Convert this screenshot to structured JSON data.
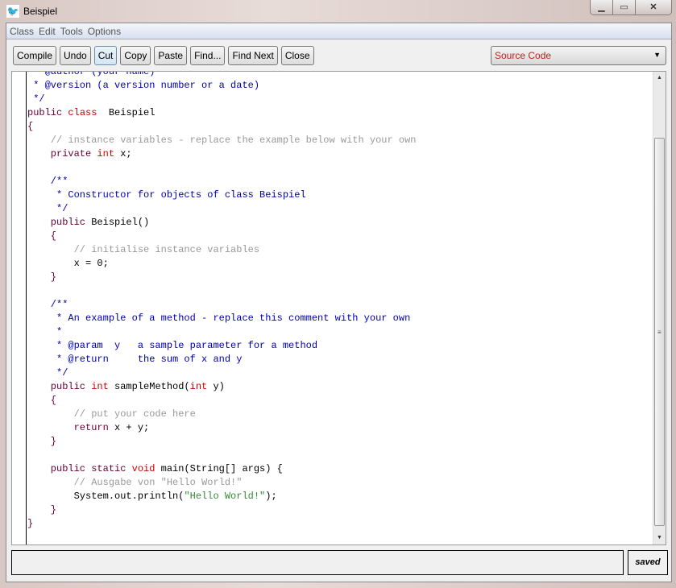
{
  "window": {
    "title": "Beispiel",
    "icon": "bluej-bird-icon",
    "controls": [
      "minimize",
      "maximize",
      "close"
    ]
  },
  "menu": [
    "Class",
    "Edit",
    "Tools",
    "Options"
  ],
  "toolbar": [
    "Compile",
    "Undo",
    "Cut",
    "Copy",
    "Paste",
    "Find...",
    "Find Next",
    "Close"
  ],
  "view_selector": {
    "selected": "Source Code"
  },
  "code_lines": [
    [
      [
        "doc",
        " * @author (your name)"
      ]
    ],
    [
      [
        "doc",
        " * @version (a version number or a date)"
      ]
    ],
    [
      [
        "doc",
        " */"
      ]
    ],
    [
      [
        "kw",
        "public "
      ],
      [
        "ty",
        "class"
      ],
      [
        "",
        "  Beispiel"
      ]
    ],
    [
      [
        "br",
        "{"
      ]
    ],
    [
      [
        "cm",
        "    // instance variables - replace the example below with your own"
      ]
    ],
    [
      [
        "kw",
        "    private "
      ],
      [
        "ty",
        "int"
      ],
      [
        "",
        " x;"
      ]
    ],
    [],
    [
      [
        "doc",
        "    /**"
      ]
    ],
    [
      [
        "doc",
        "     * Constructor for objects of class Beispiel"
      ]
    ],
    [
      [
        "doc",
        "     */"
      ]
    ],
    [
      [
        "kw",
        "    public "
      ],
      [
        "",
        "Beispiel()"
      ]
    ],
    [
      [
        "br",
        "    {"
      ]
    ],
    [
      [
        "cm",
        "        // initialise instance variables"
      ]
    ],
    [
      [
        "",
        "        x = 0;"
      ]
    ],
    [
      [
        "br",
        "    }"
      ]
    ],
    [],
    [
      [
        "doc",
        "    /**"
      ]
    ],
    [
      [
        "doc",
        "     * An example of a method - replace this comment with your own"
      ]
    ],
    [
      [
        "doc",
        "     *"
      ]
    ],
    [
      [
        "doc",
        "     * @param  y   a sample parameter for a method"
      ]
    ],
    [
      [
        "doc",
        "     * @return     the sum of x and y"
      ]
    ],
    [
      [
        "doc",
        "     */"
      ]
    ],
    [
      [
        "kw",
        "    public "
      ],
      [
        "ty",
        "int"
      ],
      [
        "",
        " sampleMethod("
      ],
      [
        "ty",
        "int"
      ],
      [
        "",
        " y)"
      ]
    ],
    [
      [
        "br",
        "    {"
      ]
    ],
    [
      [
        "cm",
        "        // put your code here"
      ]
    ],
    [
      [
        "kw",
        "        return"
      ],
      [
        "",
        " x + y;"
      ]
    ],
    [
      [
        "br",
        "    }"
      ]
    ],
    [],
    [
      [
        "kw",
        "    public static "
      ],
      [
        "ty",
        "void"
      ],
      [
        "",
        " main(String[] args) {"
      ]
    ],
    [
      [
        "cm",
        "        // Ausgabe von \"Hello World!\""
      ]
    ],
    [
      [
        "",
        "        System.out.println("
      ],
      [
        "str",
        "\"Hello World!\""
      ],
      [
        "",
        ");"
      ]
    ],
    [
      [
        "br",
        "    }"
      ]
    ],
    [
      [
        "br",
        "}"
      ]
    ]
  ],
  "status": {
    "message": "",
    "saved": "saved"
  },
  "colors": {
    "keyword": "#660033",
    "type": "#cc0000",
    "javadoc": "#0000aa",
    "comment": "#999999",
    "string": "#338833",
    "view_selector_text": "#c02020"
  }
}
